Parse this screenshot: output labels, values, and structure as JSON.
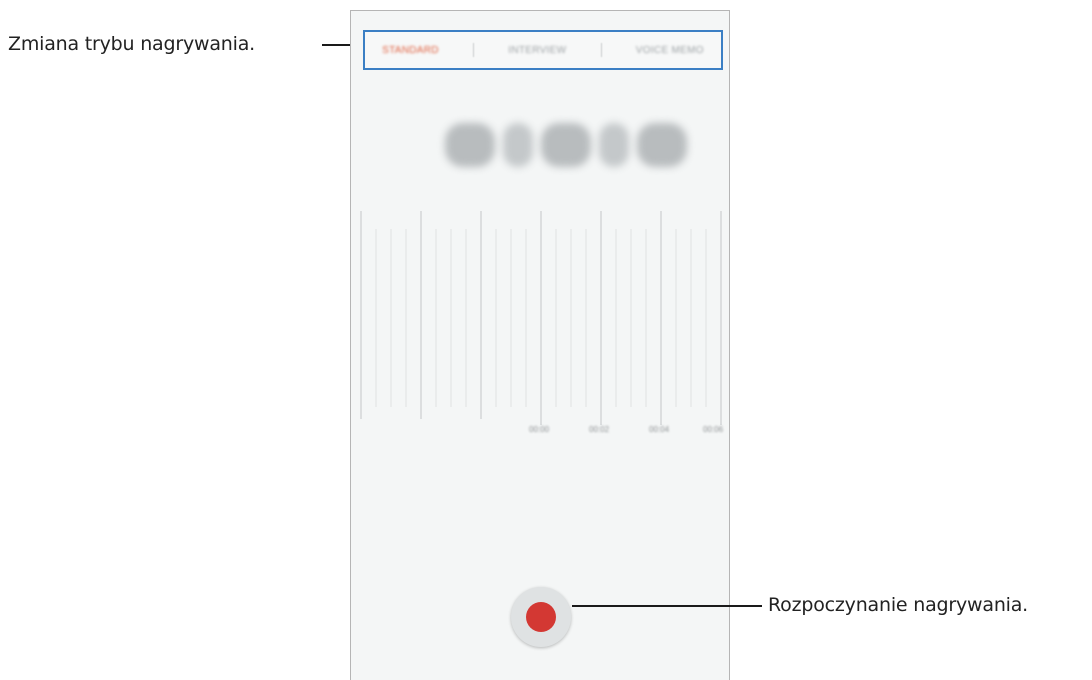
{
  "callouts": {
    "mode_change": "Zmiana trybu nagrywania.",
    "start_recording": "Rozpoczynanie nagrywania."
  },
  "mode_bar": {
    "tabs": [
      {
        "label": "STANDARD",
        "active": true
      },
      {
        "label": "INTERVIEW",
        "active": false
      },
      {
        "label": "VOICE MEMO",
        "active": false
      }
    ]
  },
  "timeline": {
    "tick_labels": [
      "00:00",
      "00:02",
      "00:04",
      "00:06"
    ]
  },
  "colors": {
    "highlight_border": "#3b7fc4",
    "active_tab": "#e0603f",
    "record_dot": "#d33833"
  },
  "icons": {
    "record": "record-icon"
  }
}
